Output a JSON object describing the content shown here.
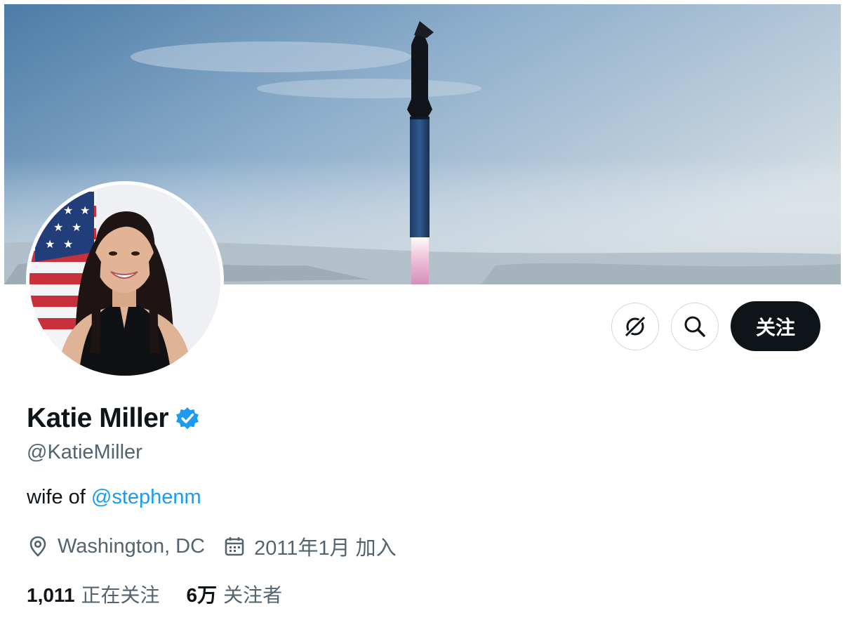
{
  "profile": {
    "display_name": "Katie Miller",
    "verified_badge": "verified-badge-icon",
    "handle": "@KatieMiller",
    "bio": {
      "prefix": "wife of ",
      "mention": "@stephenm"
    },
    "location": "Washington, DC",
    "joined": "2011年1月 加入",
    "following_count": "1,011",
    "following_label": "正在关注",
    "followers_count": "6万",
    "followers_label": "关注者"
  },
  "actions": {
    "more_icon": "grok-icon",
    "search_icon": "search-icon",
    "follow_label": "关注"
  },
  "colors": {
    "link": "#1d9bf0",
    "text_primary": "#0f1419",
    "text_secondary": "#536471",
    "follow_button": "#0f1419",
    "verified": "#1d9bf0"
  }
}
